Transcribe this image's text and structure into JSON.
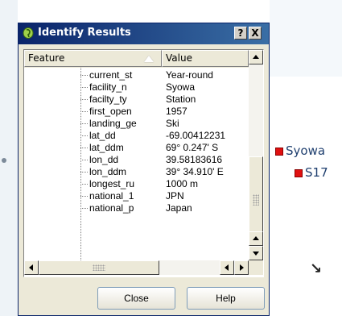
{
  "window": {
    "title": "Identify Results",
    "help_glyph": "?",
    "close_glyph": "X",
    "icon": "qgis-identify-icon"
  },
  "table": {
    "columns": [
      "Feature",
      "Value"
    ],
    "rows": [
      {
        "feature": "current_st",
        "value": "Year-round"
      },
      {
        "feature": "facility_n",
        "value": "Syowa"
      },
      {
        "feature": "facilty_ty",
        "value": "Station"
      },
      {
        "feature": "first_open",
        "value": "1957"
      },
      {
        "feature": "landing_ge",
        "value": "Ski"
      },
      {
        "feature": "lat_dd",
        "value": "-69.00412231"
      },
      {
        "feature": "lat_ddm",
        "value": "69° 0.247' S"
      },
      {
        "feature": "lon_dd",
        "value": "39.58183616"
      },
      {
        "feature": "lon_ddm",
        "value": "39° 34.910' E"
      },
      {
        "feature": "longest_ru",
        "value": "1000 m"
      },
      {
        "feature": "national_1",
        "value": "JPN"
      },
      {
        "feature": "national_p",
        "value": "Japan"
      }
    ]
  },
  "buttons": {
    "close_label": "Close",
    "help_label": "Help"
  },
  "map": {
    "labels": [
      {
        "text": "Syowa"
      },
      {
        "text": "S17"
      }
    ],
    "north_arrow": "↘",
    "marker_color": "#e01010",
    "label_color": "#1f3f6f"
  },
  "colors": {
    "titlebar_start": "#0a246a",
    "titlebar_end": "#3a6ea5",
    "dialog_bg": "#ece9d8"
  }
}
